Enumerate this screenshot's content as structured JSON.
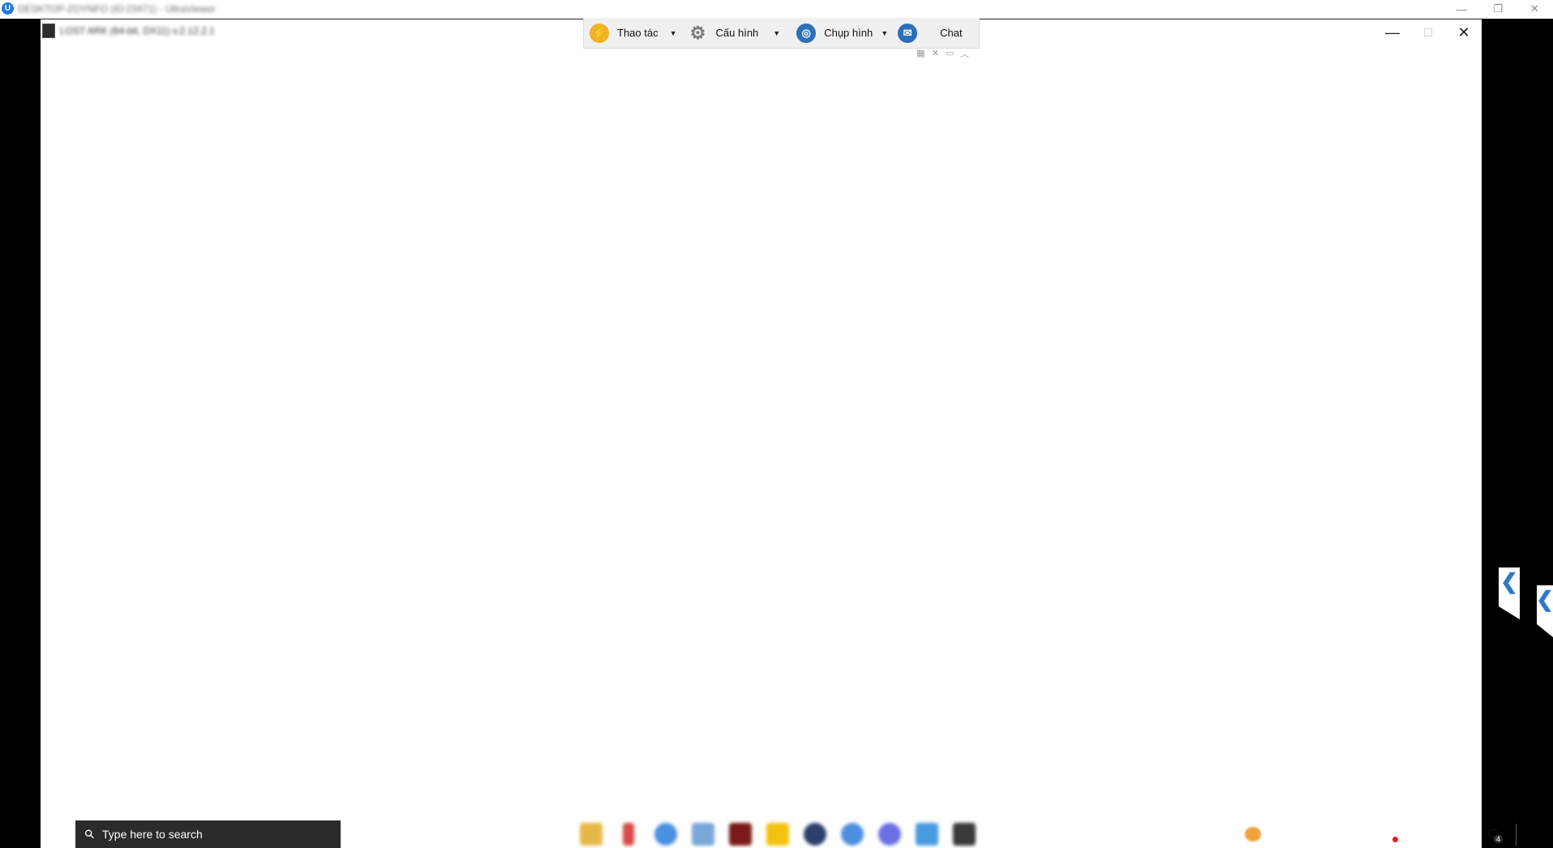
{
  "outer_window": {
    "title": "DESKTOP-ZOYNFO (ID:23471) - UltraViewer",
    "controls": {
      "minimize": "—",
      "restore": "❐",
      "close": "✕"
    }
  },
  "remote_window": {
    "title": "LOST ARK (64-bit, DX11) v.2.12.2.1",
    "controls": {
      "minimize": "—",
      "maximize": "☐",
      "close": "✕"
    }
  },
  "toolbar": {
    "action_label": "Thao tác",
    "settings_label": "Cấu hình",
    "capture_label": "Chụp hình",
    "chat_label": "Chat",
    "dropdown_glyph": "▼",
    "action_icon_color": "#f0b323",
    "capture_icon_color": "#2d6fb8",
    "chat_icon_color": "#2d6fb8"
  },
  "toolbar_mini": [
    "▦",
    "✕",
    "▭",
    "︿"
  ],
  "side_tabs": [
    "❮",
    "❮"
  ],
  "taskbar": {
    "search_placeholder": "Type here to search",
    "search_glyph": "⚲",
    "notification_count": "4",
    "notification_glyph": "🗨",
    "app_colors": [
      "#e6b84a",
      "#d94a4a",
      "#4a8fe0",
      "#7aa7d8",
      "#7a1a1a",
      "#f2c20e",
      "#2a3f6a",
      "#4a8fe0",
      "#6a6fe6",
      "#4a9ae0",
      "#3a3a3a"
    ]
  }
}
